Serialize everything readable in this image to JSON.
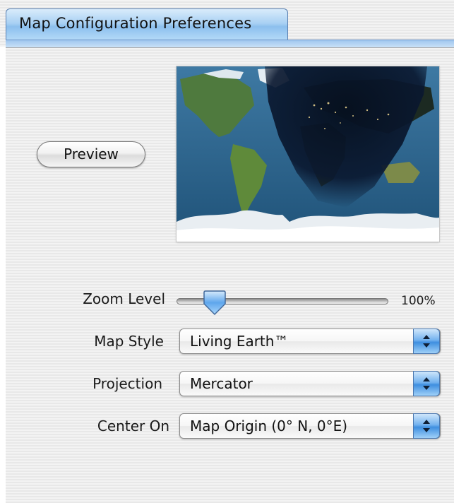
{
  "tab": {
    "label": "Map Configuration Preferences"
  },
  "preview": {
    "button_label": "Preview"
  },
  "zoom": {
    "label": "Zoom Level",
    "value_text": "100%",
    "level_fraction": 0.18
  },
  "map_style": {
    "label": "Map Style",
    "selected": "Living Earth™"
  },
  "projection": {
    "label": "Projection",
    "selected": "Mercator"
  },
  "center_on": {
    "label": "Center On",
    "selected": "Map Origin (0° N, 0°E)"
  },
  "colors": {
    "tab_blue": "#8cbfee",
    "popup_arrow_blue": "#3f8fe0",
    "ocean": "#2b5f86",
    "night": "#0b1a2e"
  },
  "icons": {
    "popup_arrows": "up-down-arrows-icon",
    "slider_thumb": "slider-thumb-icon"
  }
}
